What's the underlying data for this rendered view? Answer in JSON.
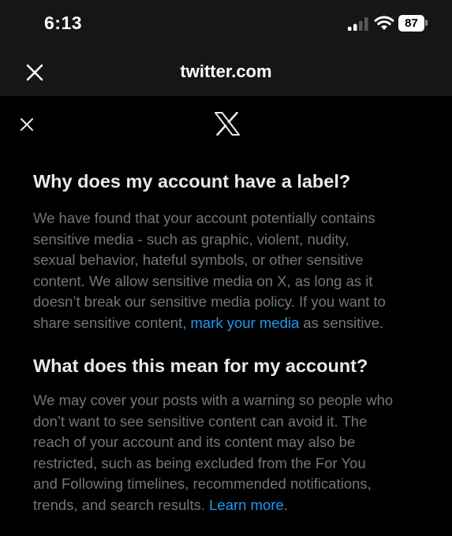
{
  "status_bar": {
    "time": "6:13",
    "battery": "87",
    "icons": [
      "cellular-signal-icon",
      "wifi-icon",
      "battery-icon"
    ]
  },
  "browser": {
    "title": "twitter.com",
    "close_icon": "close-icon"
  },
  "dialog": {
    "close_icon": "close-icon",
    "logo_icon": "x-logo-icon",
    "section1": {
      "title": "Why does my account have a label?",
      "line1": "We have found that your account potentially contains",
      "line2": "sensitive media - such as graphic, violent, nudity,",
      "line3": "sexual behavior, hateful symbols, or other sensitive",
      "line4": "content. We allow sensitive media on X, as long as it",
      "line5": "doesn’t break our sensitive media policy. If you want to",
      "line6_pre": "share sensitive content, ",
      "link": "mark your media",
      "line6_post": " as sensitive."
    },
    "section2": {
      "title": "What does this mean for my account?",
      "line1": "We may cover your posts with a warning so people who",
      "line2": "don’t want to see sensitive content can avoid it. The",
      "line3": "reach of your account and its content may also be",
      "line4": "restricted, such as being excluded from the For You",
      "line5": "and Following timelines, recommended notifications,",
      "line6_pre": "trends, and search results. ",
      "link": "Learn more",
      "line6_post": "."
    }
  },
  "colors": {
    "background": "#000000",
    "header_background": "#161616",
    "heading_text": "#e7e9ea",
    "body_text": "#71767b",
    "link": "#1d9bf0"
  }
}
